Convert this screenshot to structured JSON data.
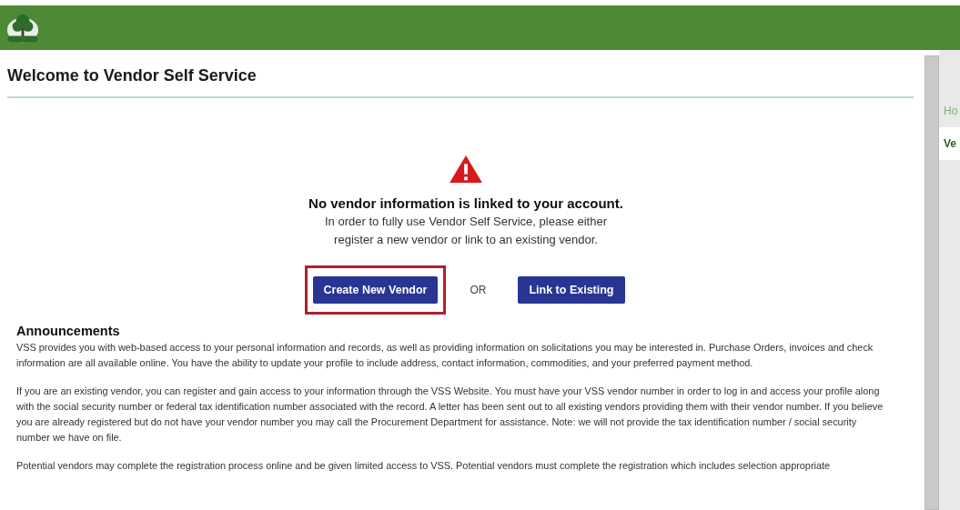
{
  "header": {
    "kind": "logo"
  },
  "page": {
    "title": "Welcome to Vendor Self Service"
  },
  "notice": {
    "heading": "No vendor information is linked to your account.",
    "message": "In order to fully use Vendor Self Service, please either register a new vendor or link to an existing vendor.",
    "actions": [
      {
        "label": "Create New Vendor",
        "highlighted": true
      },
      {
        "label": "OR",
        "kind": "separator"
      },
      {
        "label": "Link to Existing",
        "highlighted": false
      }
    ]
  },
  "announcements": {
    "title": "Announcements",
    "paragraphs": [
      "VSS provides you with web-based access to your personal information and records, as well as providing information on solicitations you may be interested in. Purchase Orders, invoices and check information are all available online. You have the ability to update your profile to include address, contact information, commodities, and your preferred payment method.",
      "If you are an existing vendor, you can register and gain access to your information through the VSS Website. You must have your VSS vendor number in order to log in and access your profile along with the social security number or federal tax identification number associated with the record. A letter has been sent out to all existing vendors providing them with their vendor number. If you believe you are already registered but do not have your vendor number you may call the Procurement Department for assistance. Note: we will not provide the tax identification number / social security number we have on file.",
      "Potential vendors may complete the registration process online and be given limited access to VSS. Potential vendors must complete the registration which includes selection appropriate"
    ]
  },
  "side_menu": [
    {
      "label": "Ho",
      "selected": false
    },
    {
      "label": "Ve",
      "selected": true
    }
  ]
}
